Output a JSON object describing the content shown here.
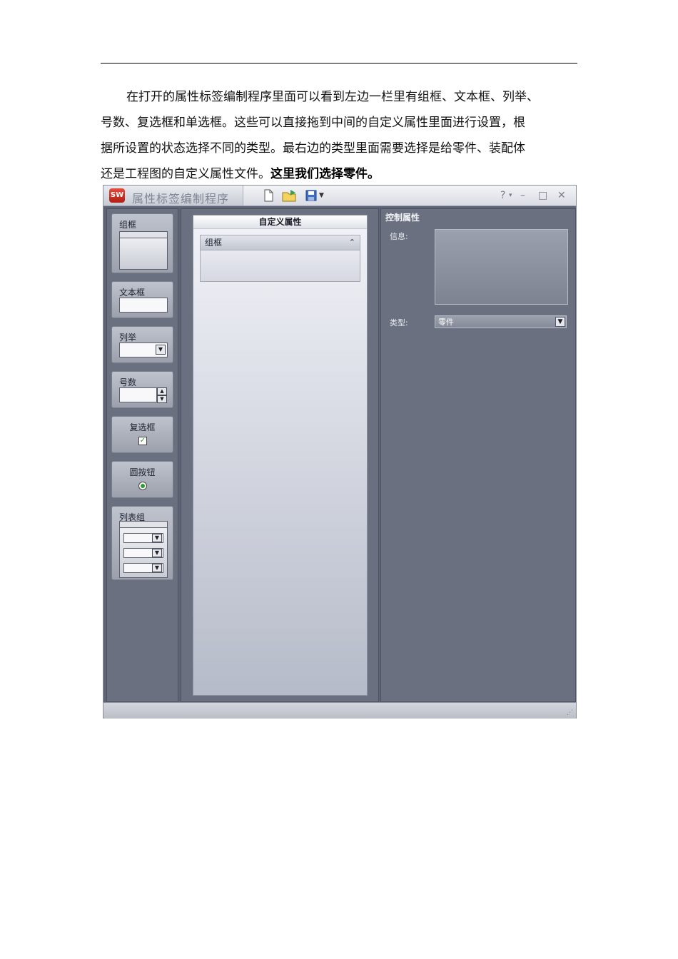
{
  "paragraph": {
    "line1": "在打开的属性标签编制程序里面可以看到左边一栏里有组框、文本框、列举、",
    "line2": "号数、复选框和单选框。这些可以直接拖到中间的自定义属性里面进行设置，根",
    "line3": "据所设置的状态选择不同的类型。最右边的类型里面需要选择是给零件、装配体",
    "line4_normal": "还是工程图的自定义属性文件。",
    "line4_bold": "这里我们选择零件。"
  },
  "window": {
    "app_icon_text": "SW",
    "title": "属性标签编制程序",
    "controls": {
      "help": "?",
      "minimize": "–",
      "maximize": "□",
      "close": "✕"
    }
  },
  "toolbox": {
    "items": [
      {
        "label": "组框"
      },
      {
        "label": "文本框"
      },
      {
        "label": "列举"
      },
      {
        "label": "号数"
      },
      {
        "label": "复选框"
      },
      {
        "label": "圆按钮"
      },
      {
        "label": "列表组"
      }
    ]
  },
  "center": {
    "header": "自定义属性",
    "group_title": "组框"
  },
  "properties": {
    "title": "控制属性",
    "info_label": "信息:",
    "type_label": "类型:",
    "type_value": "零件"
  }
}
